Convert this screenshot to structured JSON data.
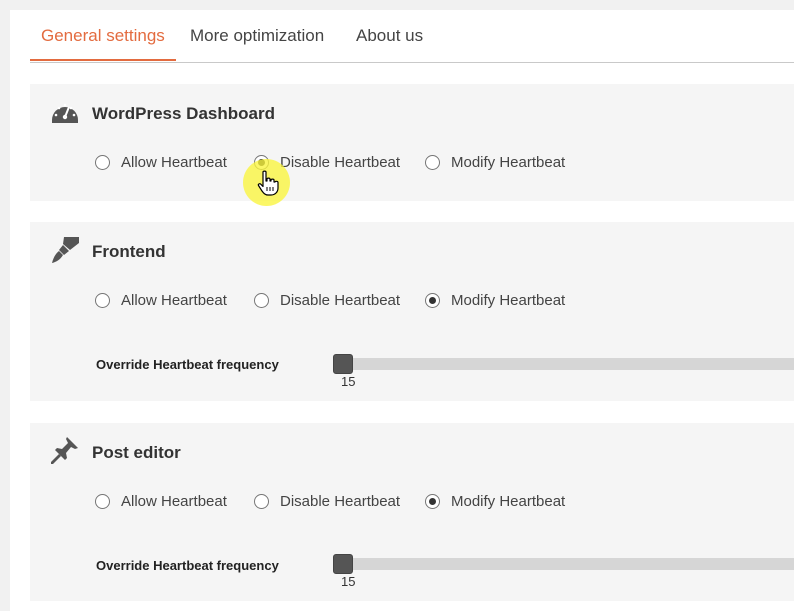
{
  "tabs": [
    {
      "label": "General settings",
      "active": true
    },
    {
      "label": "More optimization",
      "active": false
    },
    {
      "label": "About us",
      "active": false
    }
  ],
  "accent_color": "#e36b3f",
  "sections": [
    {
      "title": "WordPress Dashboard",
      "icon": "dashboard-gauge-icon",
      "options": [
        "Allow Heartbeat",
        "Disable Heartbeat",
        "Modify Heartbeat"
      ],
      "selected": "Disable Heartbeat"
    },
    {
      "title": "Frontend",
      "icon": "paintbrush-icon",
      "options": [
        "Allow Heartbeat",
        "Disable Heartbeat",
        "Modify Heartbeat"
      ],
      "selected": "Modify Heartbeat",
      "frequency_label": "Override Heartbeat frequency",
      "frequency_value": "15"
    },
    {
      "title": "Post editor",
      "icon": "pushpin-icon",
      "options": [
        "Allow Heartbeat",
        "Disable Heartbeat",
        "Modify Heartbeat"
      ],
      "selected": "Modify Heartbeat",
      "frequency_label": "Override Heartbeat frequency",
      "frequency_value": "15"
    }
  ]
}
